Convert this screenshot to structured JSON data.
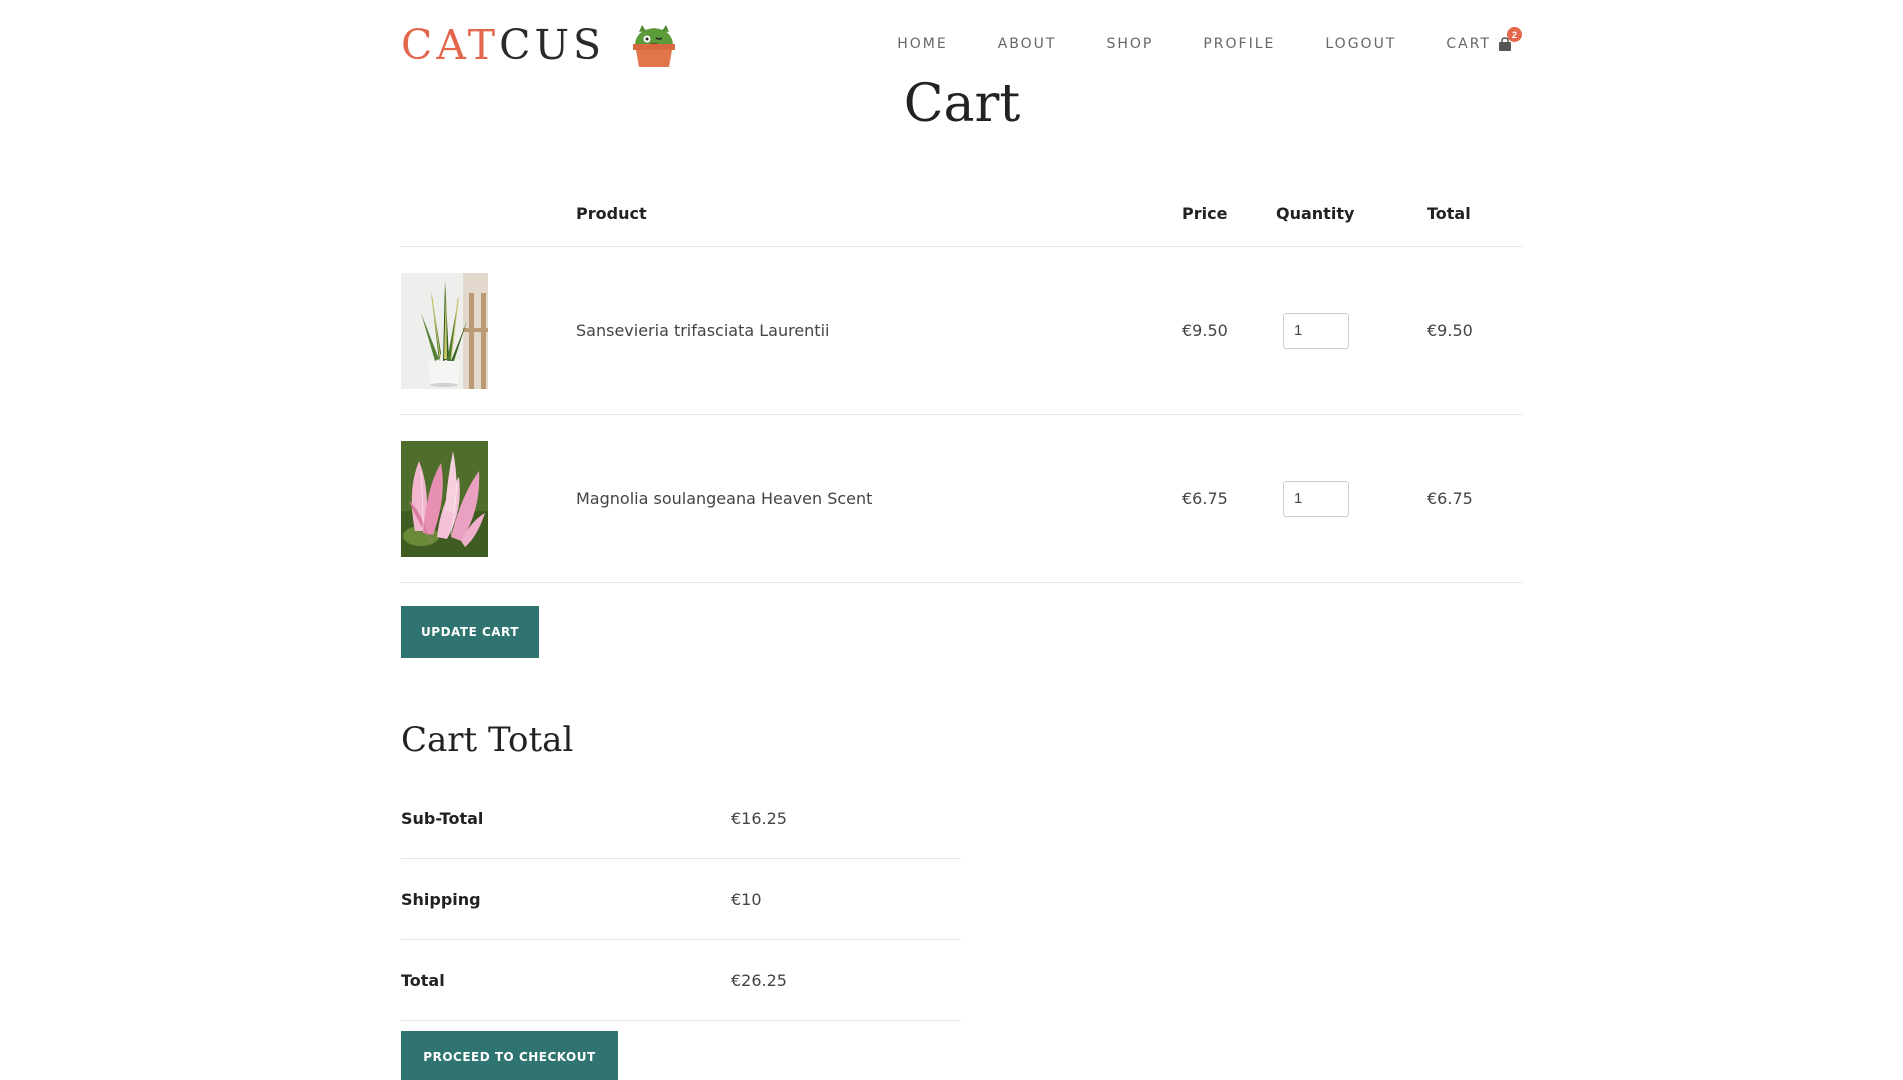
{
  "brand": {
    "logo_part1": "CAT",
    "logo_part2": "CUS",
    "accent_color": "#e2674b",
    "button_color": "#2f7470"
  },
  "nav": {
    "items": [
      {
        "label": "HOME"
      },
      {
        "label": "ABOUT"
      },
      {
        "label": "SHOP"
      },
      {
        "label": "PROFILE"
      },
      {
        "label": "LOGOUT"
      }
    ],
    "cart_label": "CART",
    "cart_icon": "shopping-bag-icon",
    "cart_count": "2"
  },
  "page": {
    "title": "Cart"
  },
  "cart": {
    "headers": {
      "product": "Product",
      "price": "Price",
      "quantity": "Quantity",
      "total": "Total"
    },
    "rows": [
      {
        "product": "Sansevieria trifasciata Laurentii",
        "price": "€9.50",
        "quantity": "1",
        "total": "€9.50",
        "image": "snake-plant-image"
      },
      {
        "product": "Magnolia soulangeana Heaven Scent",
        "price": "€6.75",
        "quantity": "1",
        "total": "€6.75",
        "image": "magnolia-flower-image"
      }
    ],
    "update_label": "UPDATE CART"
  },
  "totals": {
    "title": "Cart Total",
    "subtotal_label": "Sub-Total",
    "subtotal_value": "€16.25",
    "shipping_label": "Shipping",
    "shipping_value": "€10",
    "total_label": "Total",
    "total_value": "€26.25",
    "checkout_label": "PROCEED TO CHECKOUT"
  }
}
